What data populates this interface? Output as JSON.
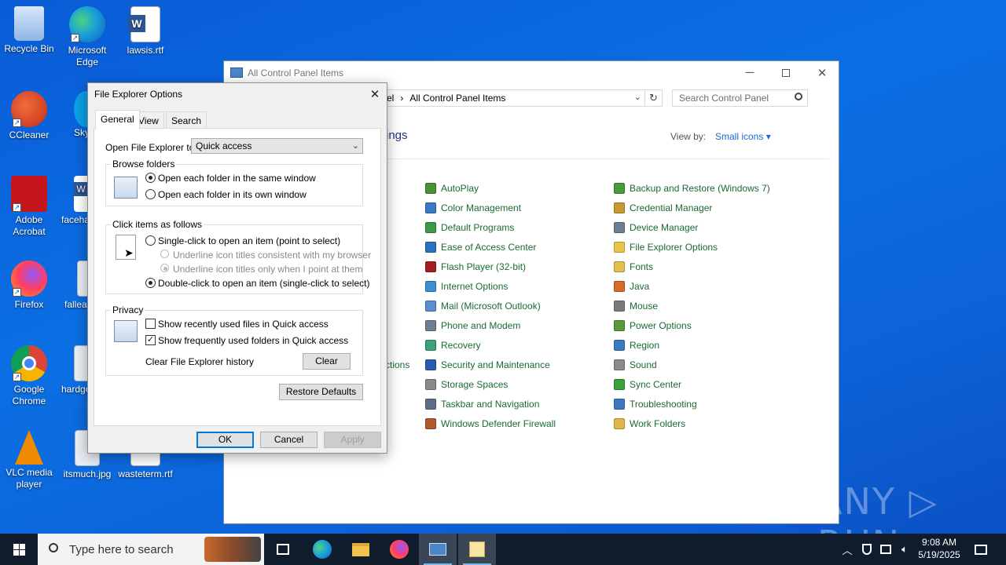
{
  "desktop": {
    "icons": [
      {
        "label": "Recycle Bin",
        "color": "#9fc7f0"
      },
      {
        "label": "Microsoft Edge",
        "color": "#1aa0d8"
      },
      {
        "label": "lawsis.rtf",
        "color": "#2b5797"
      },
      {
        "label": "CCleaner",
        "color": "#d84a2f"
      },
      {
        "label": "Sky",
        "color": "#0aa0e8"
      },
      {
        "label": "Adobe Acrobat",
        "color": "#c4161c"
      },
      {
        "label": "faceha",
        "color": "#2b5797"
      },
      {
        "label": "Firefox",
        "color": "#ff7139"
      },
      {
        "label": "fallea",
        "color": "#dfe6ef"
      },
      {
        "label": "Google Chrome",
        "color": "#2f9a4a"
      },
      {
        "label": "hardgo",
        "color": "#dfe6ef"
      },
      {
        "label": "VLC media player",
        "color": "#f08a00"
      },
      {
        "label": "itsmuch.jpg",
        "color": "#dfe6ef"
      },
      {
        "label": "wasteterm.rtf",
        "color": "#2b5797"
      }
    ]
  },
  "control_panel": {
    "title": "All Control Panel Items",
    "address_prefix": "el",
    "address_sep": "›",
    "address_current": "All Control Panel Items",
    "search_placeholder": "Search Control Panel",
    "heading_partial": "ings",
    "view_by_label": "View by:",
    "view_by_value": "Small icons ▾",
    "partial_item": "ctions",
    "column1": [
      {
        "label": "AutoPlay",
        "color": "#4a8f3a"
      },
      {
        "label": "Color Management",
        "color": "#3c78c8"
      },
      {
        "label": "Default Programs",
        "color": "#3a9a48"
      },
      {
        "label": "Ease of Access Center",
        "color": "#2d6fc0"
      },
      {
        "label": "Flash Player (32-bit)",
        "color": "#a51e1e"
      },
      {
        "label": "Internet Options",
        "color": "#3a8fd0"
      },
      {
        "label": "Mail (Microsoft Outlook)",
        "color": "#5a8ed0"
      },
      {
        "label": "Phone and Modem",
        "color": "#6c7f92"
      },
      {
        "label": "Recovery",
        "color": "#3aa17a"
      },
      {
        "label": "Security and Maintenance",
        "color": "#2a5ab0"
      },
      {
        "label": "Storage Spaces",
        "color": "#8a8a8a"
      },
      {
        "label": "Taskbar and Navigation",
        "color": "#5c6f86"
      },
      {
        "label": "Windows Defender Firewall",
        "color": "#b0582a"
      }
    ],
    "column2": [
      {
        "label": "Backup and Restore (Windows 7)",
        "color": "#4a9a3a"
      },
      {
        "label": "Credential Manager",
        "color": "#c89a30"
      },
      {
        "label": "Device Manager",
        "color": "#6c7f92"
      },
      {
        "label": "File Explorer Options",
        "color": "#e8c44a"
      },
      {
        "label": "Fonts",
        "color": "#e0c24a"
      },
      {
        "label": "Java",
        "color": "#d86a2a"
      },
      {
        "label": "Mouse",
        "color": "#7a7a7a"
      },
      {
        "label": "Power Options",
        "color": "#5a9a3a"
      },
      {
        "label": "Region",
        "color": "#3a7ac0"
      },
      {
        "label": "Sound",
        "color": "#8a8a8a"
      },
      {
        "label": "Sync Center",
        "color": "#3aa03a"
      },
      {
        "label": "Troubleshooting",
        "color": "#3a78c0"
      },
      {
        "label": "Work Folders",
        "color": "#e0b84a"
      }
    ]
  },
  "dialog": {
    "title": "File Explorer Options",
    "tabs": [
      "General",
      "View",
      "Search"
    ],
    "open_label": "Open File Explorer to:",
    "open_value": "Quick access",
    "browse_group": "Browse folders",
    "browse_same": "Open each folder in the same window",
    "browse_own": "Open each folder in its own window",
    "click_group": "Click items as follows",
    "single_click": "Single-click to open an item (point to select)",
    "underline_browser": "Underline icon titles consistent with my browser",
    "underline_point": "Underline icon titles only when I point at them",
    "double_click": "Double-click to open an item (single-click to select)",
    "privacy_group": "Privacy",
    "recent_files": "Show recently used files in Quick access",
    "frequent_folders": "Show frequently used folders in Quick access",
    "clear_history_label": "Clear File Explorer history",
    "clear_button": "Clear",
    "restore_button": "Restore Defaults",
    "ok": "OK",
    "cancel": "Cancel",
    "apply": "Apply",
    "checkmark": "✓"
  },
  "taskbar": {
    "search_placeholder": "Type here to search",
    "time": "9:08 AM",
    "date": "5/19/2025"
  },
  "watermark": "ANY ▷ RUN"
}
